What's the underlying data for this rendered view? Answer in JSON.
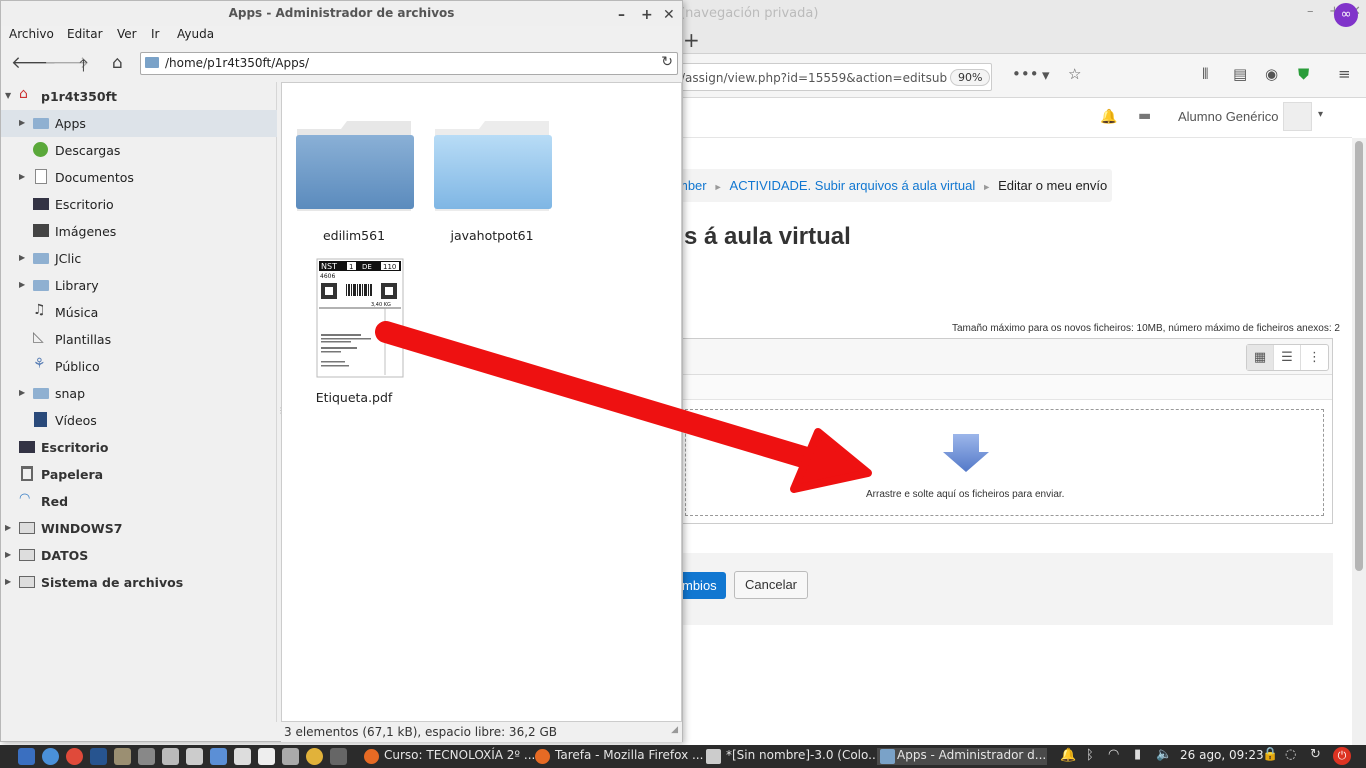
{
  "browser": {
    "window_title": "(navegación privada)",
    "new_tab": "+",
    "url": "/assign/view.php?id=15559&action=editsub",
    "zoom": "90%",
    "user_name": "Alumno Genérico",
    "breadcrumb": {
      "item1": "mber",
      "item2": "ACTIVIDADE. Subir arquivos á aula virtual",
      "item3": "Editar o meu envío"
    },
    "page_heading": "s á aula virtual",
    "max_files_info": "Tamaño máximo para os novos ficheiros: 10MB, número máximo de ficheiros anexos: 2",
    "drop_text": "Arrastre e solte aquí os ficheiros para enviar.",
    "save_button": "mbios",
    "cancel_button": "Cancelar"
  },
  "file_manager": {
    "title": "Apps - Administrador de archivos",
    "menu": [
      "Archivo",
      "Editar",
      "Ver",
      "Ir",
      "Ayuda"
    ],
    "location": "/home/p1r4t350ft/Apps/",
    "sidebar": {
      "home": "p1r4t350ft",
      "items": [
        "Apps",
        "Descargas",
        "Documentos",
        "Escritorio",
        "Imágenes",
        "JClic",
        "Library",
        "Música",
        "Plantillas",
        "Público",
        "snap",
        "Vídeos"
      ],
      "devices": [
        "Escritorio",
        "Papelera",
        "Red",
        "WINDOWS7",
        "DATOS",
        "Sistema de archivos"
      ]
    },
    "files": [
      {
        "name": "edilim561",
        "type": "folder"
      },
      {
        "name": "javahotpot61",
        "type": "folder"
      },
      {
        "name": "Etiqueta.pdf",
        "type": "pdf"
      }
    ],
    "label_preview": {
      "row1": "NST",
      "row1b": "1",
      "row1c": "DE",
      "row1d": "110",
      "weight": "3,40 KG",
      "code": "4606"
    },
    "status": "3 elementos (67,1 kB), espacio libre: 36,2 GB"
  },
  "taskbar": {
    "tasks": [
      {
        "label": "Curso: TECNOLOXÍA 2º ...",
        "icon": "firefox-icon"
      },
      {
        "label": "Tarefa - Mozilla Firefox ...",
        "icon": "firefox-icon"
      },
      {
        "label": "*[Sin nombre]-3.0 (Colo...",
        "icon": "gimp-icon"
      },
      {
        "label": "Apps - Administrador d...",
        "icon": "folder-icon"
      }
    ],
    "clock": "26 ago, 09:23"
  },
  "colors": {
    "accent": "#1177d1",
    "annotation_arrow": "#ee1111",
    "folder": "#7aa2c8",
    "taskbar": "#2b2b2b"
  }
}
